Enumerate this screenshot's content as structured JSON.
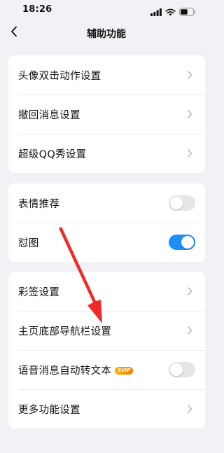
{
  "status_bar": {
    "time": "18:26"
  },
  "nav": {
    "title": "辅助功能"
  },
  "group1": [
    {
      "label": "头像双击动作设置"
    },
    {
      "label": "撤回消息设置"
    },
    {
      "label": "超级QQ秀设置"
    }
  ],
  "group2": [
    {
      "label": "表情推荐",
      "toggle": "off"
    },
    {
      "label": "怼图",
      "toggle": "on"
    }
  ],
  "group3": [
    {
      "label": "彩签设置"
    },
    {
      "label": "主页底部导航栏设置"
    },
    {
      "label": "语音消息自动转文本",
      "badge": "SVIP",
      "toggle": "off"
    },
    {
      "label": "更多功能设置"
    }
  ],
  "colors": {
    "accent": "#1e8df5",
    "annotation_arrow": "#f02a2a"
  }
}
